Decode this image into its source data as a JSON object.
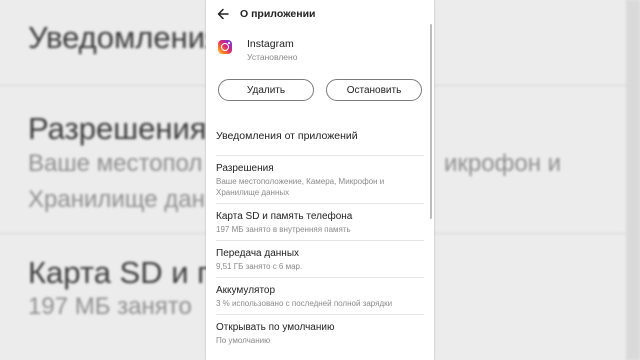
{
  "header": {
    "title": "О приложении"
  },
  "app": {
    "name": "Instagram",
    "status": "Установлено"
  },
  "actions": {
    "uninstall": "Удалить",
    "stop": "Остановить"
  },
  "notifications_label": "Уведомления от приложений",
  "items": [
    {
      "title": "Разрешения",
      "sub": "Ваше местоположение, Камера, Микрофон и Хранилище данных"
    },
    {
      "title": "Карта SD и память телефона",
      "sub": "197 МБ занято в внутренняя память"
    },
    {
      "title": "Передача данных",
      "sub": "9,51 ГБ занято с 6 мар."
    },
    {
      "title": "Аккумулятор",
      "sub": "3 % использовано с последней полной зарядки"
    },
    {
      "title": "Открывать по умолчанию",
      "sub": "По умолчанию"
    }
  ],
  "background": {
    "notif": "Уведомления",
    "perm_title": "Разрешения",
    "perm_sub_1_left": "Ваше местопол",
    "perm_sub_1_right": "икрофон и",
    "perm_sub_2_left": "Хранилище дан",
    "card_title": "Карта SD и п",
    "card_sub": "197 МБ занято"
  }
}
